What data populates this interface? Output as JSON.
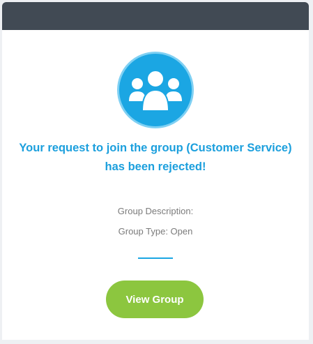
{
  "notification": {
    "icon": "group-icon",
    "title_line1": "Your request to join the group (Customer Service)",
    "title_line2": "has been rejected!",
    "group_description_label": "Group Description:",
    "group_type": "Group Type: Open",
    "view_group_label": "View Group"
  },
  "colors": {
    "header": "#414a54",
    "accent_blue": "#1ba6e3",
    "button_green": "#8cc63f",
    "muted_text": "#7b7b7b"
  }
}
